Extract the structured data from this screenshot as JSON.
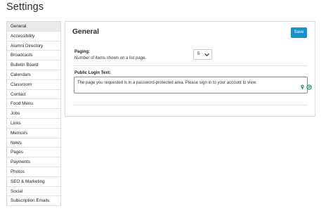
{
  "page": {
    "title": "Settings"
  },
  "sidebar": {
    "items": [
      {
        "label": "General",
        "active": true
      },
      {
        "label": "Accessibility"
      },
      {
        "label": "Alumni Directory"
      },
      {
        "label": "Broadcasts"
      },
      {
        "label": "Bulletin Board"
      },
      {
        "label": "Calendars"
      },
      {
        "label": "Classroom"
      },
      {
        "label": "Contact"
      },
      {
        "label": "Food Menu"
      },
      {
        "label": "Jobs"
      },
      {
        "label": "Links"
      },
      {
        "label": "Memoirs"
      },
      {
        "label": "News"
      },
      {
        "label": "Pages"
      },
      {
        "label": "Payments"
      },
      {
        "label": "Photos"
      },
      {
        "label": "SEO & Marketing"
      },
      {
        "label": "Social"
      },
      {
        "label": "Subscription Emails"
      }
    ]
  },
  "panel": {
    "title": "General",
    "save_label": "Save",
    "paging": {
      "label": "Paging:",
      "help": "Number of items shown on a list page.",
      "value": "5"
    },
    "login": {
      "label": "Public Login Text:",
      "value": "The page you requested is in a password-protected area. Please sign in to your account to view."
    }
  },
  "colors": {
    "accent": "#1b8fcc",
    "active_item_bg": "#e9e9e9",
    "grammar_icon": "#1f9c6e",
    "pin_icon": "#2e9e5e"
  },
  "icons": [
    "chevron-down-icon",
    "pin-icon",
    "grammar-icon"
  ]
}
